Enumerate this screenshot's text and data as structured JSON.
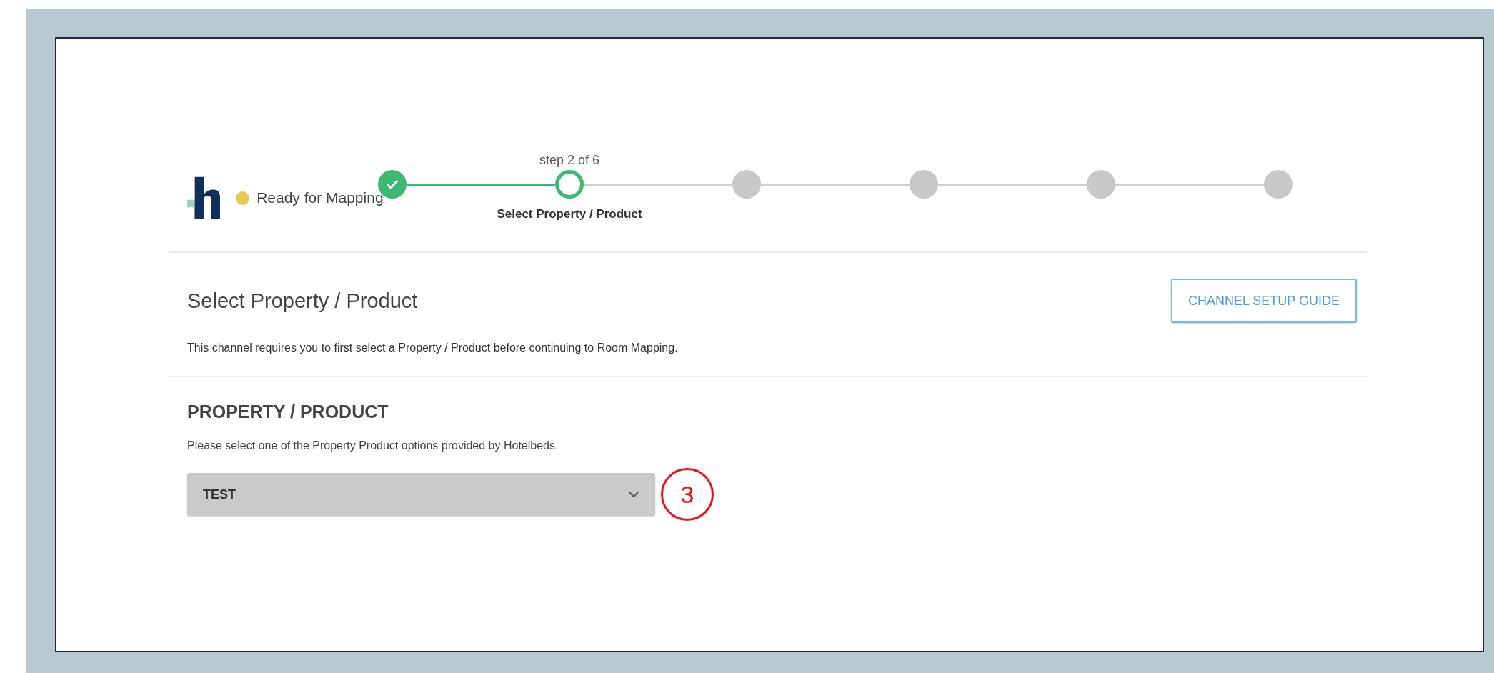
{
  "status": {
    "label": "Ready for Mapping",
    "color": "#e8c95a"
  },
  "stepper": {
    "caption": "step 2 of 6",
    "steps": [
      {
        "kind": "done"
      },
      {
        "kind": "current",
        "label": "Select Property / Product"
      },
      {
        "kind": "pending"
      },
      {
        "kind": "pending"
      },
      {
        "kind": "pending"
      },
      {
        "kind": "pending"
      }
    ]
  },
  "page": {
    "title": "Select Property / Product",
    "guide_button": "CHANNEL SETUP GUIDE",
    "description": "This channel requires you to first select a Property / Product before continuing to Room Mapping."
  },
  "section": {
    "heading": "PROPERTY / PRODUCT",
    "hint": "Please select one of the Property Product options provided by Hotelbeds.",
    "select_value": "TEST",
    "callout": "3"
  }
}
